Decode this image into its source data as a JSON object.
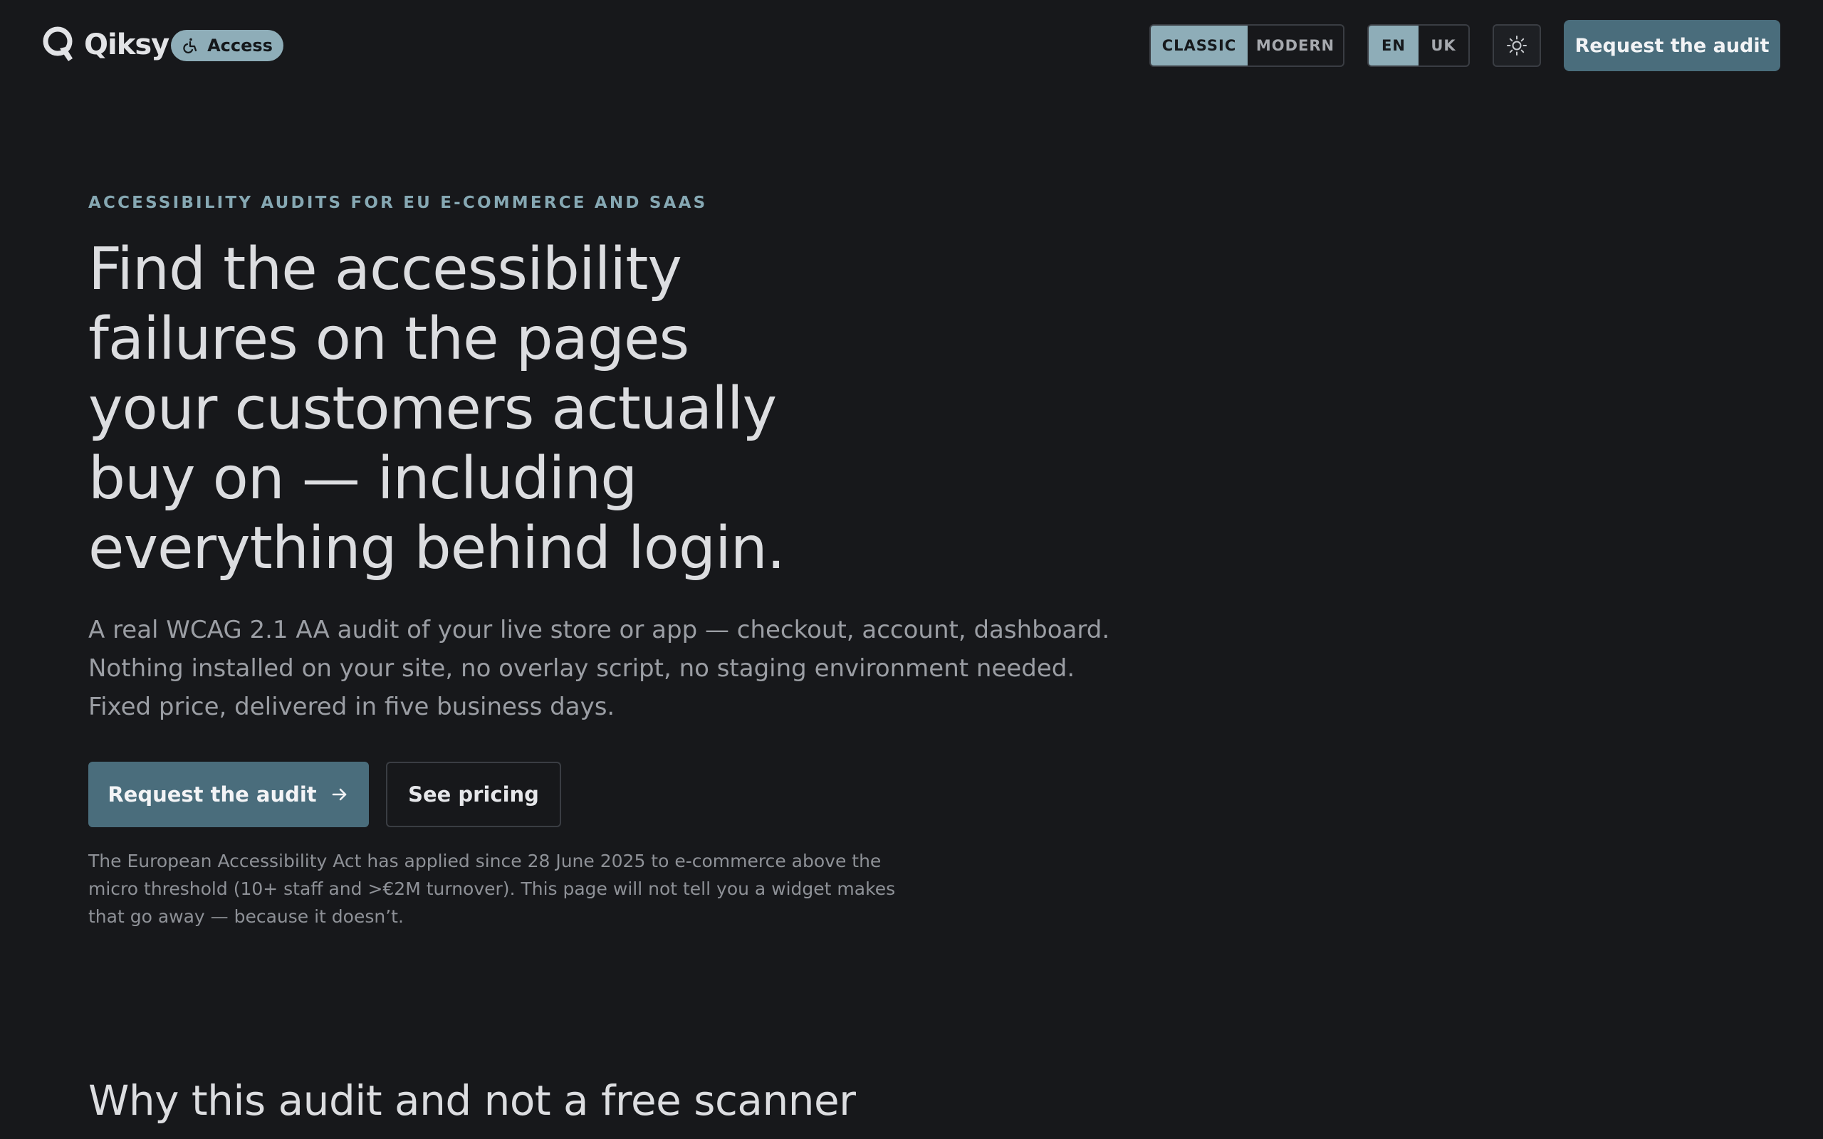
{
  "header": {
    "brand": "Qiksy",
    "access_label": "Access",
    "style_toggle": [
      "CLASSIC",
      "MODERN"
    ],
    "style_active": "CLASSIC",
    "lang_toggle": [
      "EN",
      "UK"
    ],
    "lang_active": "EN",
    "theme_icon": "sun-icon",
    "cta": "Request the audit"
  },
  "hero": {
    "eyebrow": "ACCESSIBILITY AUDITS FOR EU E-COMMERCE AND SAAS",
    "title_lines": [
      "Find the accessibility",
      "failures on the pages",
      "your customers actually",
      "buy on — including",
      "everything behind login."
    ],
    "lede_lines": [
      "A real WCAG 2.1 AA audit of your live store or app — checkout, account, dashboard.",
      "Nothing installed on your site, no overlay script, no staging environment needed.",
      "Fixed price, delivered in five business days."
    ],
    "primary_cta": "Request the audit",
    "secondary_cta": "See pricing",
    "note_lines": [
      "The European Accessibility Act has applied since 28 June 2025 to e-commerce above the",
      "micro threshold (10+ staff and >€2M turnover). This page will not tell you a widget makes",
      "that go away — because it doesn’t."
    ]
  },
  "section": {
    "title": "Why this audit and not a free scanner"
  },
  "colors": {
    "background": "#17181b",
    "accent": "#4a6d7c",
    "accent_light": "#8eadb8",
    "text": "#dcdde0",
    "muted": "#9b9ea4"
  }
}
